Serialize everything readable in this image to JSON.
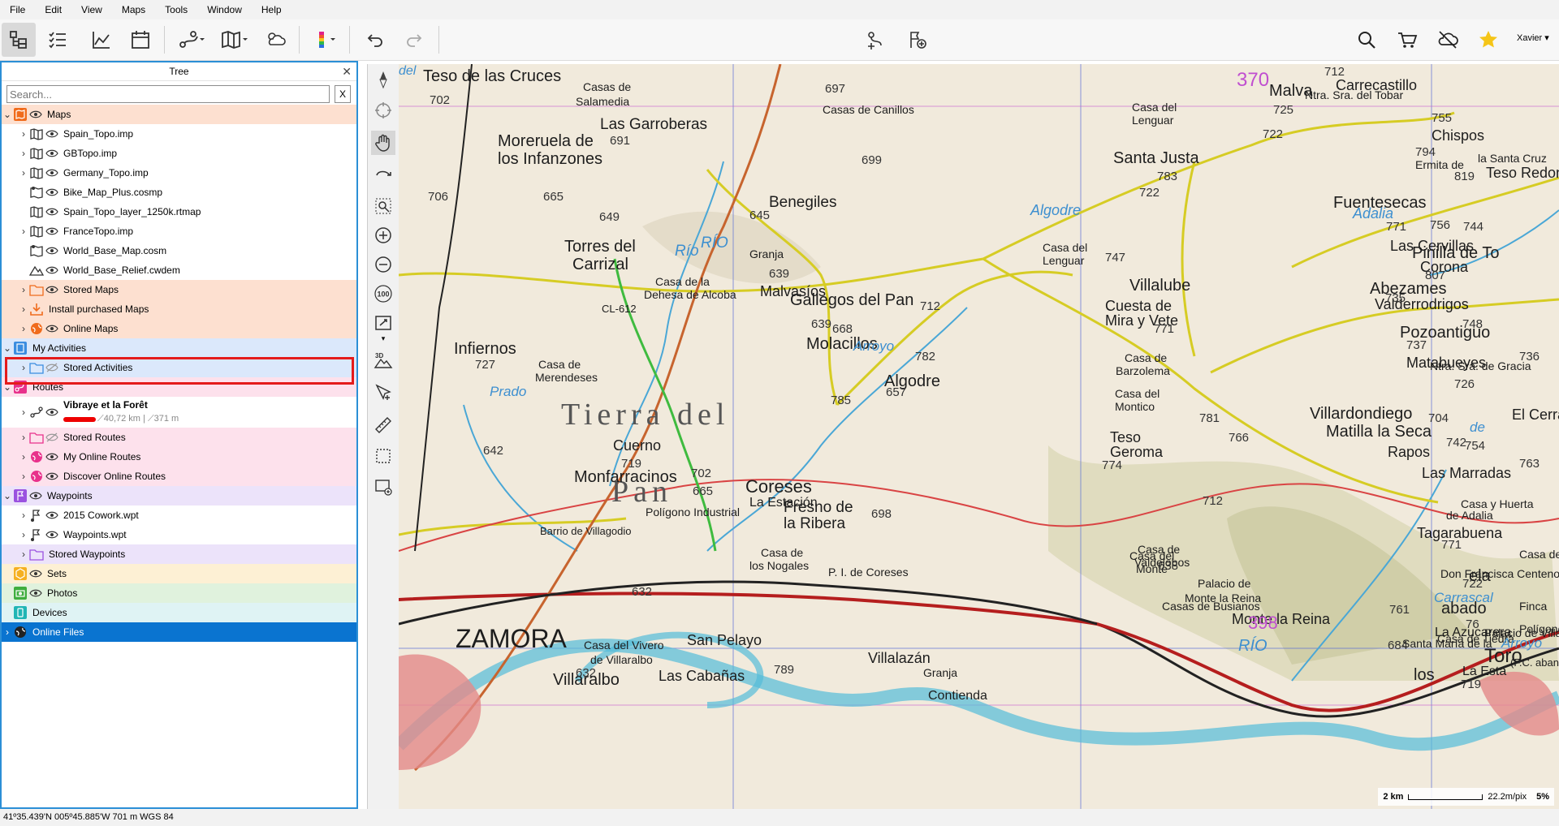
{
  "menu": [
    "File",
    "Edit",
    "View",
    "Maps",
    "Tools",
    "Window",
    "Help"
  ],
  "toolbar": {
    "user": "Xavier ▾"
  },
  "tree": {
    "title": "Tree",
    "search_placeholder": "Search...",
    "clear_label": "X",
    "rows": [
      {
        "label": "Maps",
        "section": "maps"
      },
      {
        "label": "Spain_Topo.imp"
      },
      {
        "label": "GBTopo.imp"
      },
      {
        "label": "Germany_Topo.imp"
      },
      {
        "label": "Bike_Map_Plus.cosmp"
      },
      {
        "label": "Spain_Topo_layer_1250k.rtmap"
      },
      {
        "label": "FranceTopo.imp"
      },
      {
        "label": "World_Base_Map.cosm"
      },
      {
        "label": "World_Base_Relief.cwdem"
      },
      {
        "label": "Stored Maps"
      },
      {
        "label": "Install purchased Maps"
      },
      {
        "label": "Online Maps"
      },
      {
        "label": "My Activities",
        "section": "activities"
      },
      {
        "label": "Stored Activities"
      },
      {
        "label": "Routes",
        "section": "routes"
      },
      {
        "label": "Vibraye et la Forêt",
        "distance": "40,72 km",
        "elevation": "371 m"
      },
      {
        "label": "Stored Routes"
      },
      {
        "label": "My Online Routes"
      },
      {
        "label": "Discover Online Routes"
      },
      {
        "label": "Waypoints",
        "section": "waypoints"
      },
      {
        "label": "2015 Cowork.wpt"
      },
      {
        "label": "Waypoints.wpt"
      },
      {
        "label": "Stored Waypoints"
      },
      {
        "label": "Sets",
        "section": "sets"
      },
      {
        "label": "Photos",
        "section": "photos"
      },
      {
        "label": "Devices",
        "section": "devices"
      },
      {
        "label": "Online Files",
        "section": "online"
      }
    ]
  },
  "map": {
    "places": [
      {
        "t": "Teso de las Cruces",
        "s": 20
      },
      {
        "t": "Casas de",
        "s": 14
      },
      {
        "t": "Salamedia",
        "s": 14
      },
      {
        "t": "702",
        "s": 15
      },
      {
        "t": "Las Garroberas",
        "s": 19
      },
      {
        "t": "691",
        "s": 15
      },
      {
        "t": "Moreruela de",
        "s": 20
      },
      {
        "t": "los Infanzones",
        "s": 20
      },
      {
        "t": "706",
        "s": 15
      },
      {
        "t": "665",
        "s": 15
      },
      {
        "t": "649",
        "s": 15
      },
      {
        "t": "Torres del",
        "s": 20
      },
      {
        "t": "Carrizal",
        "s": 20
      },
      {
        "t": "Infiernos",
        "s": 20
      },
      {
        "t": "727",
        "s": 15
      },
      {
        "t": "Casa de",
        "s": 14
      },
      {
        "t": "Merendeses",
        "s": 14
      },
      {
        "t": "Tierra del",
        "s": 38
      },
      {
        "t": "Pan",
        "s": 38
      },
      {
        "t": "642",
        "s": 15
      },
      {
        "t": "Monfarracinos",
        "s": 20
      },
      {
        "t": "Cuerno",
        "s": 18
      },
      {
        "t": "719",
        "s": 15
      },
      {
        "t": "702",
        "s": 15
      },
      {
        "t": "665",
        "s": 15
      },
      {
        "t": "Coreses",
        "s": 22
      },
      {
        "t": "La Estación",
        "s": 16
      },
      {
        "t": "Fresno de",
        "s": 19
      },
      {
        "t": "la Ribera",
        "s": 19
      },
      {
        "t": "698",
        "s": 15
      },
      {
        "t": "Polígono Industrial",
        "s": 14
      },
      {
        "t": "Barrio de Villagodio",
        "s": 13
      },
      {
        "t": "Casa de",
        "s": 14
      },
      {
        "t": "los Nogales",
        "s": 14
      },
      {
        "t": "P. I. de Coreses",
        "s": 14
      },
      {
        "t": "632",
        "s": 15
      },
      {
        "t": "ZAMORA",
        "s": 32
      },
      {
        "t": "San Pelayo",
        "s": 18
      },
      {
        "t": "Casa del Vivero",
        "s": 14
      },
      {
        "t": "de Villaralbo",
        "s": 14
      },
      {
        "t": "Villaralbo",
        "s": 20
      },
      {
        "t": "Las Cabañas",
        "s": 18
      },
      {
        "t": "632",
        "s": 15
      },
      {
        "t": "Villalazán",
        "s": 18
      },
      {
        "t": "Granja",
        "s": 14
      },
      {
        "t": "789",
        "s": 15
      },
      {
        "t": "Contienda",
        "s": 16
      },
      {
        "t": "Casas de Canillos",
        "s": 14
      },
      {
        "t": "697",
        "s": 15
      },
      {
        "t": "699",
        "s": 15
      },
      {
        "t": "Benegiles",
        "s": 19
      },
      {
        "t": "645",
        "s": 15
      },
      {
        "t": "Granja",
        "s": 14
      },
      {
        "t": "Río",
        "s": 19
      },
      {
        "t": "RÍO",
        "s": 19
      },
      {
        "t": "Casa de la",
        "s": 14
      },
      {
        "t": "Dehesa de Alcoba",
        "s": 14
      },
      {
        "t": "639",
        "s": 15
      },
      {
        "t": "Malvasíos",
        "s": 18
      },
      {
        "t": "639",
        "s": 15
      },
      {
        "t": "Molacillos",
        "s": 20
      },
      {
        "t": "668",
        "s": 15
      },
      {
        "t": "CL-612",
        "s": 13
      },
      {
        "t": "Gallegos del Pan",
        "s": 20
      },
      {
        "t": "712",
        "s": 15
      },
      {
        "t": "Arroyo",
        "s": 17
      },
      {
        "t": "782",
        "s": 15
      },
      {
        "t": "Algodre",
        "s": 20
      },
      {
        "t": "657",
        "s": 15
      },
      {
        "t": "785",
        "s": 15
      },
      {
        "t": "Prado",
        "s": 17
      },
      {
        "t": "Santa Justa",
        "s": 20
      },
      {
        "t": "783",
        "s": 15
      },
      {
        "t": "722",
        "s": 15
      },
      {
        "t": "Algodre",
        "s": 18
      },
      {
        "t": "Casa del",
        "s": 14
      },
      {
        "t": "Lenguar",
        "s": 14
      },
      {
        "t": "747",
        "s": 15
      },
      {
        "t": "Villalube",
        "s": 20
      },
      {
        "t": "Cuesta de",
        "s": 18
      },
      {
        "t": "Mira y Vete",
        "s": 18
      },
      {
        "t": "771",
        "s": 15
      },
      {
        "t": "Casa de",
        "s": 14
      },
      {
        "t": "Barzolema",
        "s": 14
      },
      {
        "t": "Casa del",
        "s": 14
      },
      {
        "t": "Montico",
        "s": 14
      },
      {
        "t": "Teso",
        "s": 18
      },
      {
        "t": "Geroma",
        "s": 18
      },
      {
        "t": "774",
        "s": 15
      },
      {
        "t": "781",
        "s": 15
      },
      {
        "t": "766",
        "s": 15
      },
      {
        "t": "712",
        "s": 15
      },
      {
        "t": "Casa de",
        "s": 14
      },
      {
        "t": "Valdelobos",
        "s": 14
      },
      {
        "t": "Palacio de",
        "s": 14
      },
      {
        "t": "Monte la Reina",
        "s": 14
      },
      {
        "t": "Casa del",
        "s": 14
      },
      {
        "t": "Monte",
        "s": 14
      },
      {
        "t": "638",
        "s": 15
      },
      {
        "t": "Casas de Busianos",
        "s": 14
      },
      {
        "t": "Monte la Reina",
        "s": 18
      },
      {
        "t": "398",
        "s": 22
      },
      {
        "t": "RÍO",
        "s": 20
      },
      {
        "t": "370",
        "s": 24
      },
      {
        "t": "Malva",
        "s": 20
      },
      {
        "t": "725",
        "s": 15
      },
      {
        "t": "Casa del",
        "s": 14
      },
      {
        "t": "Lenguar",
        "s": 14
      },
      {
        "t": "722",
        "s": 15
      },
      {
        "t": "Ntra. Sra. del Tobar",
        "s": 14
      },
      {
        "t": "712",
        "s": 15
      },
      {
        "t": "Carrecastillo",
        "s": 18
      },
      {
        "t": "755",
        "s": 15
      },
      {
        "t": "Chispos",
        "s": 18
      },
      {
        "t": "794",
        "s": 15
      },
      {
        "t": "Ermita de",
        "s": 14
      },
      {
        "t": "la Santa Cruz",
        "s": 14
      },
      {
        "t": "Teso Redondo",
        "s": 18
      },
      {
        "t": "819",
        "s": 15
      },
      {
        "t": "Adalia",
        "s": 18
      },
      {
        "t": "Fuentesecas",
        "s": 20
      },
      {
        "t": "771",
        "s": 15
      },
      {
        "t": "Las Cervillas",
        "s": 18
      },
      {
        "t": "756",
        "s": 15
      },
      {
        "t": "744",
        "s": 15
      },
      {
        "t": "Pinilla de To",
        "s": 20
      },
      {
        "t": "Corona",
        "s": 18
      },
      {
        "t": "807",
        "s": 15
      },
      {
        "t": "Abezames",
        "s": 20
      },
      {
        "t": "Valderrodrigos",
        "s": 18
      },
      {
        "t": "735",
        "s": 15
      },
      {
        "t": "Pozoantiguo",
        "s": 20
      },
      {
        "t": "737",
        "s": 15
      },
      {
        "t": "Matabueyes",
        "s": 18
      },
      {
        "t": "748",
        "s": 15
      },
      {
        "t": "Ntra. Sra. de Gracia",
        "s": 14
      },
      {
        "t": "Villardondiego",
        "s": 20
      },
      {
        "t": "Matilla la Seca",
        "s": 20
      },
      {
        "t": "736",
        "s": 15
      },
      {
        "t": "726",
        "s": 15
      },
      {
        "t": "704",
        "s": 15
      },
      {
        "t": "de",
        "s": 17
      },
      {
        "t": "El Cerral",
        "s": 18
      },
      {
        "t": "754",
        "s": 15
      },
      {
        "t": "Rapos",
        "s": 18
      },
      {
        "t": "742",
        "s": 15
      },
      {
        "t": "763",
        "s": 15
      },
      {
        "t": "Las Marradas",
        "s": 18
      },
      {
        "t": "Casa y Huerta",
        "s": 14
      },
      {
        "t": "de Adalia",
        "s": 14
      },
      {
        "t": "Tagarabuena",
        "s": 18
      },
      {
        "t": "771",
        "s": 15
      },
      {
        "t": "Casa de",
        "s": 14
      },
      {
        "t": "Don Francisca Centeno",
        "s": 14
      },
      {
        "t": "722",
        "s": 15
      },
      {
        "t": "Carrascal",
        "s": 17
      },
      {
        "t": "761",
        "s": 15
      },
      {
        "t": "Casa de Tiedra",
        "s": 14
      },
      {
        "t": "684",
        "s": 15
      },
      {
        "t": "Arroyo",
        "s": 17
      },
      {
        "t": "Palacio de Villachica",
        "s": 14
      },
      {
        "t": "Toro",
        "s": 24
      },
      {
        "t": "La Esta",
        "s": 16
      },
      {
        "t": "La Azucarera",
        "s": 16
      },
      {
        "t": "Santa María de la",
        "s": 14
      },
      {
        "t": "Finca",
        "s": 14
      },
      {
        "t": "Polígono In",
        "s": 14
      },
      {
        "t": "(F.C. abandonado)",
        "s": 13
      },
      {
        "t": "719",
        "s": 15
      },
      {
        "t": "ela",
        "s": 20
      },
      {
        "t": "los",
        "s": 20
      },
      {
        "t": "76",
        "s": 15
      },
      {
        "t": "abado",
        "s": 20
      },
      {
        "t": "del",
        "s": 16
      }
    ],
    "scale": {
      "distance": "2 km",
      "resolution": "22.2m/pix",
      "zoom": "5%"
    }
  },
  "status": {
    "coords": "41º35.439'N 005º45.885'W   701 m   WGS 84"
  }
}
